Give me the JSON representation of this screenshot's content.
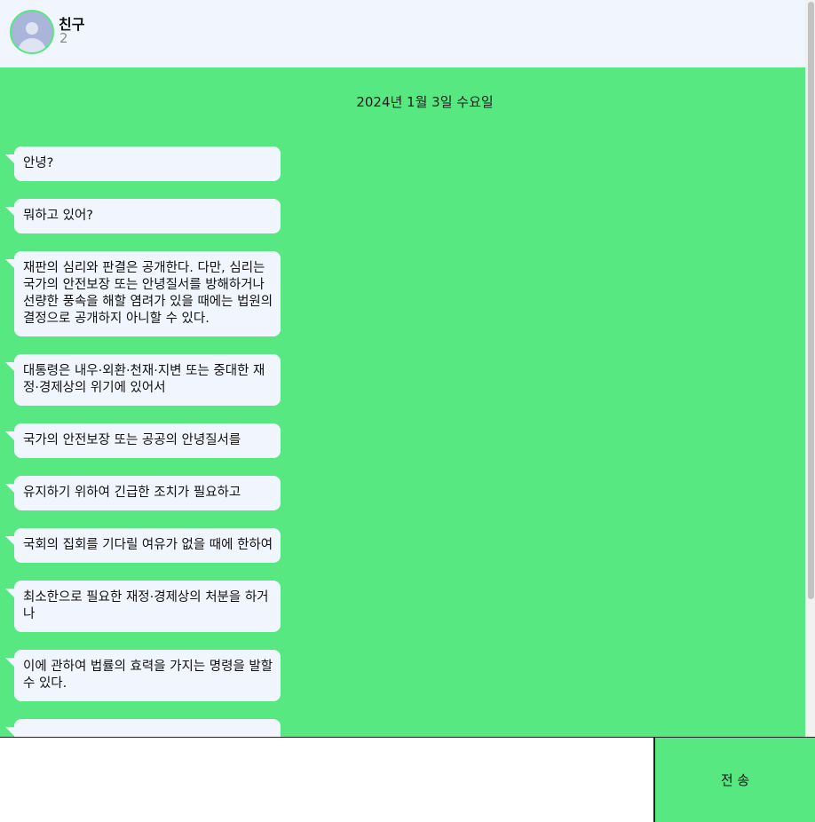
{
  "header": {
    "title": "친구",
    "member_count": "2",
    "avatar_icon": "user-avatar-icon"
  },
  "chat": {
    "date_divider": "2024년 1월 3일 수요일",
    "messages": [
      {
        "text": "안녕?"
      },
      {
        "text": "뭐하고 있어?"
      },
      {
        "text": "재판의 심리와 판결은 공개한다. 다만, 심리는 국가의 안전보장 또는 안녕질서를 방해하거나 선량한 풍속을 해할 염려가 있을 때에는 법원의 결정으로 공개하지 아니할 수 있다."
      },
      {
        "text": "대통령은 내우·외환·천재·지변 또는 중대한 재정·경제상의 위기에 있어서"
      },
      {
        "text": "국가의 안전보장 또는 공공의 안녕질서를"
      },
      {
        "text": "유지하기 위하여 긴급한 조치가 필요하고"
      },
      {
        "text": "국회의 집회를 기다릴 여유가 없을 때에 한하여"
      },
      {
        "text": "최소한으로 필요한 재정·경제상의 처분을 하거나"
      },
      {
        "text": "이에 관하여 법률의 효력을 가지는 명령을 발할 수 있다."
      },
      {
        "text": ""
      }
    ]
  },
  "composer": {
    "input_value": "",
    "send_label": "전 송"
  },
  "colors": {
    "accent": "#57e882",
    "header_bg": "#f1f5fd",
    "bubble_bg": "#f1f5fd"
  }
}
